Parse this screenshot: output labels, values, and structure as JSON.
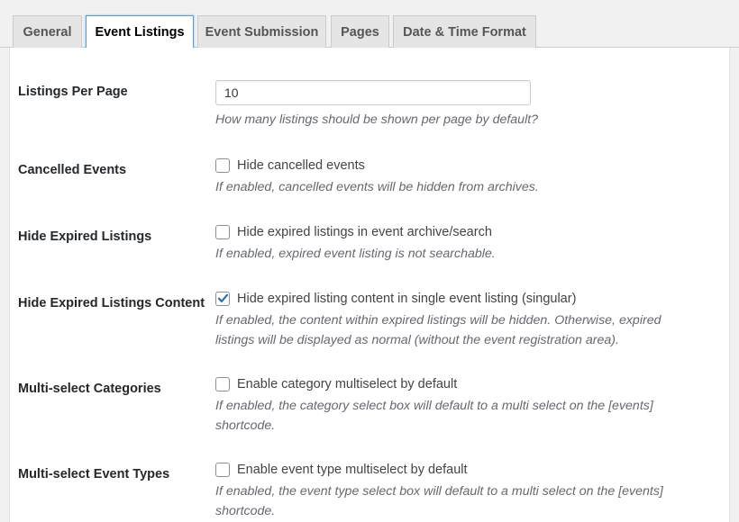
{
  "tabs": [
    {
      "label": "General",
      "active": false
    },
    {
      "label": "Event Listings",
      "active": true
    },
    {
      "label": "Event Submission",
      "active": false
    },
    {
      "label": "Pages",
      "active": false
    },
    {
      "label": "Date & Time Format",
      "active": false
    }
  ],
  "settings": {
    "listings_per_page": {
      "label": "Listings Per Page",
      "value": "10",
      "description": "How many listings should be shown per page by default?"
    },
    "cancelled_events": {
      "label": "Cancelled Events",
      "checkbox_label": "Hide cancelled events",
      "checked": false,
      "description": "If enabled, cancelled events will be hidden from archives."
    },
    "hide_expired": {
      "label": "Hide Expired Listings",
      "checkbox_label": "Hide expired listings in event archive/search",
      "checked": false,
      "description": "If enabled, expired event listing is not searchable."
    },
    "hide_expired_content": {
      "label": "Hide Expired Listings Content",
      "checkbox_label": "Hide expired listing content in single event listing (singular)",
      "checked": true,
      "description_line1": "If enabled, the content within expired listings will be hidden. Otherwise, expired",
      "description_line2": "listings will be displayed as normal (without the event registration area)."
    },
    "multiselect_categories": {
      "label": "Multi-select Categories",
      "checkbox_label": "Enable category multiselect by default",
      "checked": false,
      "description_line1": "If enabled, the category select box will default to a multi select on the [events]",
      "description_line2": "shortcode."
    },
    "multiselect_types": {
      "label": "Multi-select Event Types",
      "checkbox_label": "Enable event type multiselect by default",
      "checked": false,
      "description_line1": "If enabled, the event type select box will default to a multi select on the [events]",
      "description_line2": "shortcode."
    }
  },
  "colors": {
    "accent": "#2271b1",
    "active_tab_border": "#5b9dd9"
  }
}
